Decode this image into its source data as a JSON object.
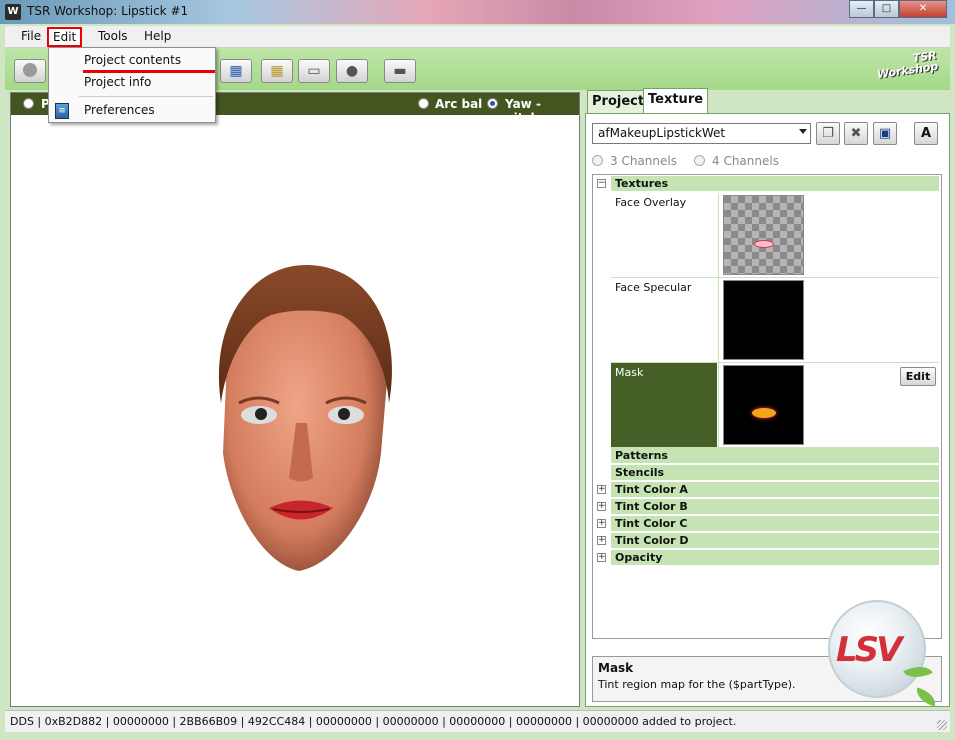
{
  "window": {
    "title": "TSR Workshop: Lipstick #1",
    "app_icon": "W",
    "controls": [
      "minimize-icon",
      "maximize-icon",
      "close-icon"
    ]
  },
  "menu": {
    "items": [
      "File",
      "Edit",
      "Tools",
      "Help"
    ],
    "active": "Edit"
  },
  "edit_menu": {
    "items": [
      "Project contents",
      "Project info",
      "Preferences"
    ],
    "highlighted": "Project contents"
  },
  "toolbar": {
    "logo_line1": "TSR",
    "logo_line2": "Workshop"
  },
  "viewport": {
    "partial_label": "P",
    "mode_arcball": "Arc bal",
    "mode_yawpitch": "Yaw - pitch",
    "selected_mode": "Yaw - pitch"
  },
  "panel": {
    "tabs": [
      "Project",
      "Texture"
    ],
    "active_tab": "Texture",
    "material": "afMakeupLipstickWet",
    "text_button": "A",
    "channels": [
      "3 Channels",
      "4 Channels"
    ],
    "textures_header": "Textures",
    "textures": [
      {
        "name": "Face Overlay",
        "preview": "checker-lips"
      },
      {
        "name": "Face Specular",
        "preview": "black"
      },
      {
        "name": "Mask",
        "preview": "black-mask",
        "action": "Edit"
      }
    ],
    "sections": [
      "Patterns",
      "Stencils",
      "Tint Color A",
      "Tint Color B",
      "Tint Color C",
      "Tint Color D",
      "Opacity"
    ],
    "expandable_sections": [
      "Tint Color A",
      "Tint Color B",
      "Tint Color C",
      "Tint Color D",
      "Opacity"
    ]
  },
  "info": {
    "title": "Mask",
    "description": "Tint region map for the ($partType)."
  },
  "status": {
    "text": "DDS | 0xB2D882 | 00000000 | 2BB66B09 | 492CC484 | 00000000 | 00000000 | 00000000 | 00000000 | 00000000 added to project."
  },
  "watermark": {
    "text": "LSV"
  },
  "colors": {
    "viewport_header": "#44561f",
    "toolbar_green": "#a4d888",
    "section_green": "#c5e3b3",
    "menu_highlight": "#e00000"
  }
}
